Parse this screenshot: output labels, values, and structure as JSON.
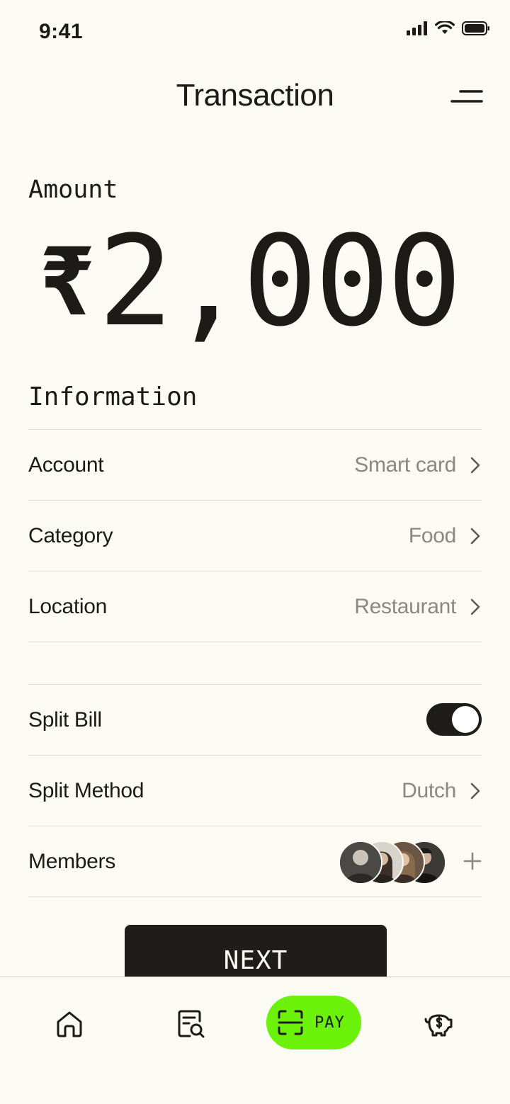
{
  "status": {
    "time": "9:41"
  },
  "header": {
    "title": "Transaction"
  },
  "amount": {
    "label": "Amount",
    "currency": "₹",
    "value": "2,000"
  },
  "information": {
    "heading": "Information",
    "rows": [
      {
        "label": "Account",
        "value": "Smart card"
      },
      {
        "label": "Category",
        "value": "Food"
      },
      {
        "label": "Location",
        "value": "Restaurant"
      }
    ]
  },
  "split": {
    "bill_label": "Split Bill",
    "bill_enabled": true,
    "method_label": "Split Method",
    "method_value": "Dutch",
    "members_label": "Members",
    "member_count": 4
  },
  "actions": {
    "next_label": "NEXT"
  },
  "tabbar": {
    "items": [
      {
        "icon": "home-icon"
      },
      {
        "icon": "search-document-icon"
      },
      {
        "icon": "scan-icon",
        "label": "PAY"
      },
      {
        "icon": "piggy-bank-icon"
      }
    ],
    "accent": "#6cf20a"
  },
  "colors": {
    "background": "#fbfaf3",
    "text": "#1c1b17",
    "muted": "#8a8980",
    "accent": "#6cf20a"
  }
}
